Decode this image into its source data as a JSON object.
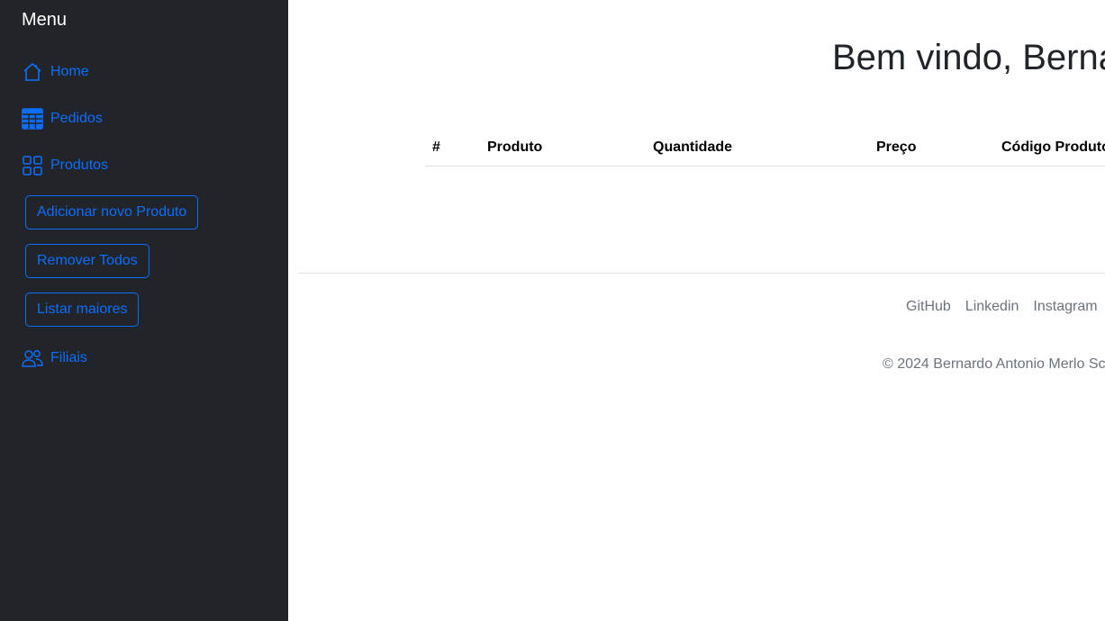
{
  "sidebar": {
    "title": "Menu",
    "items": [
      {
        "label": "Home",
        "icon": "house-icon"
      },
      {
        "label": "Pedidos",
        "icon": "table-icon"
      },
      {
        "label": "Produtos",
        "icon": "grid-icon"
      },
      {
        "label": "Filiais",
        "icon": "people-icon"
      }
    ],
    "product_actions": [
      "Adicionar novo Produto",
      "Remover Todos",
      "Listar maiores"
    ]
  },
  "main": {
    "welcome": "Bem vindo, Berna",
    "table": {
      "columns": [
        "#",
        "Produto",
        "Quantidade",
        "Preço",
        "Código Produto"
      ],
      "rows": []
    }
  },
  "footer": {
    "links": [
      "GitHub",
      "Linkedin",
      "Instagram"
    ],
    "copyright": "© 2024 Bernardo Antonio Merlo Sc"
  },
  "colors": {
    "sidebar_bg": "#212529",
    "accent": "#0d6efd",
    "muted": "#6c757d"
  }
}
